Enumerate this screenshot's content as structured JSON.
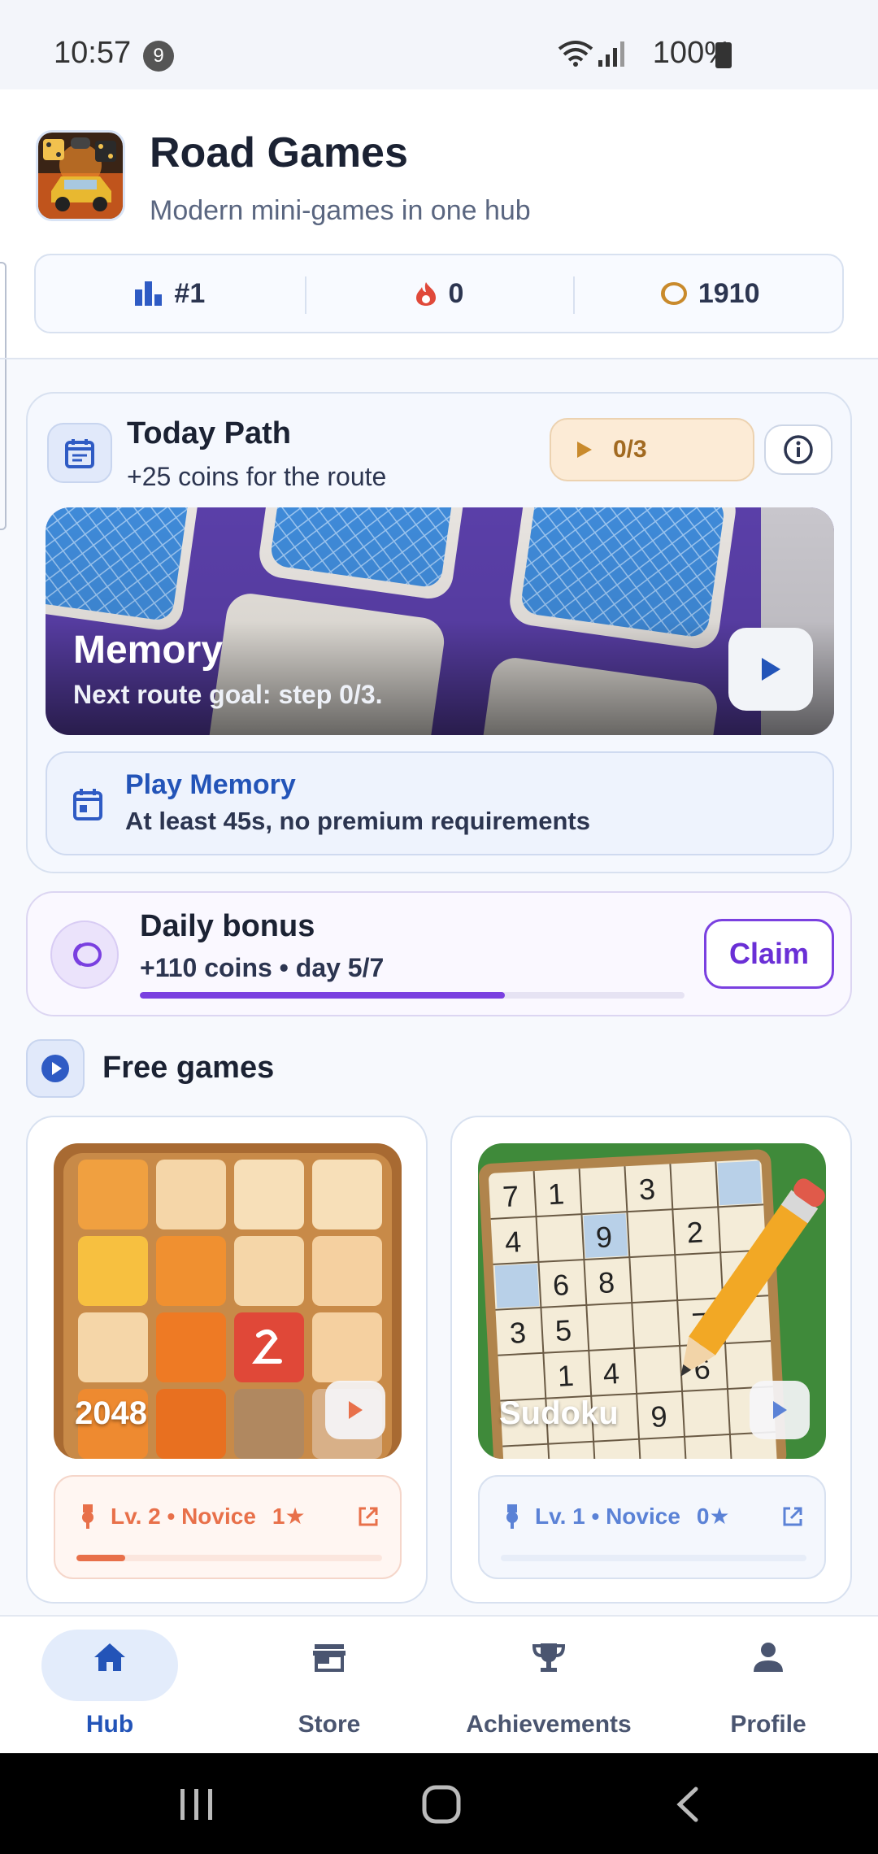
{
  "status_bar": {
    "time": "10:57",
    "notification_count": "9",
    "battery": "100%"
  },
  "app": {
    "title": "Road Games",
    "subtitle": "Modern mini-games in one hub"
  },
  "stats": {
    "rank": "#1",
    "streak": "0",
    "coins": "1910"
  },
  "today_path": {
    "title": "Today Path",
    "subtitle": "+25 coins for the route",
    "progress": "0/3",
    "hero_title": "Memory",
    "hero_subtitle": "Next route goal: step 0/3.",
    "task_title": "Play Memory",
    "task_desc": "At least 45s, no premium requirements"
  },
  "daily_bonus": {
    "title": "Daily bonus",
    "subtitle": "+110 coins • day 5/7",
    "progress_fraction": 0.67,
    "claim_label": "Claim",
    "accent": "#7a40e0"
  },
  "free_games": {
    "label": "Free games",
    "games": [
      {
        "name": "2048",
        "level": "Lv. 2 • Novice",
        "stars": "1★",
        "progress_fraction": 0.16,
        "accent": "#e8704a"
      },
      {
        "name": "Sudoku",
        "level": "Lv. 1 • Novice",
        "stars": "0★",
        "progress_fraction": 0.0,
        "accent": "#5b82d6"
      }
    ]
  },
  "bottom_nav": {
    "items": [
      "Hub",
      "Store",
      "Achievements",
      "Profile"
    ],
    "active": "Hub"
  },
  "colors": {
    "primary": "#2354b8",
    "coin": "#c98a2c",
    "streak": "#e0493a"
  }
}
